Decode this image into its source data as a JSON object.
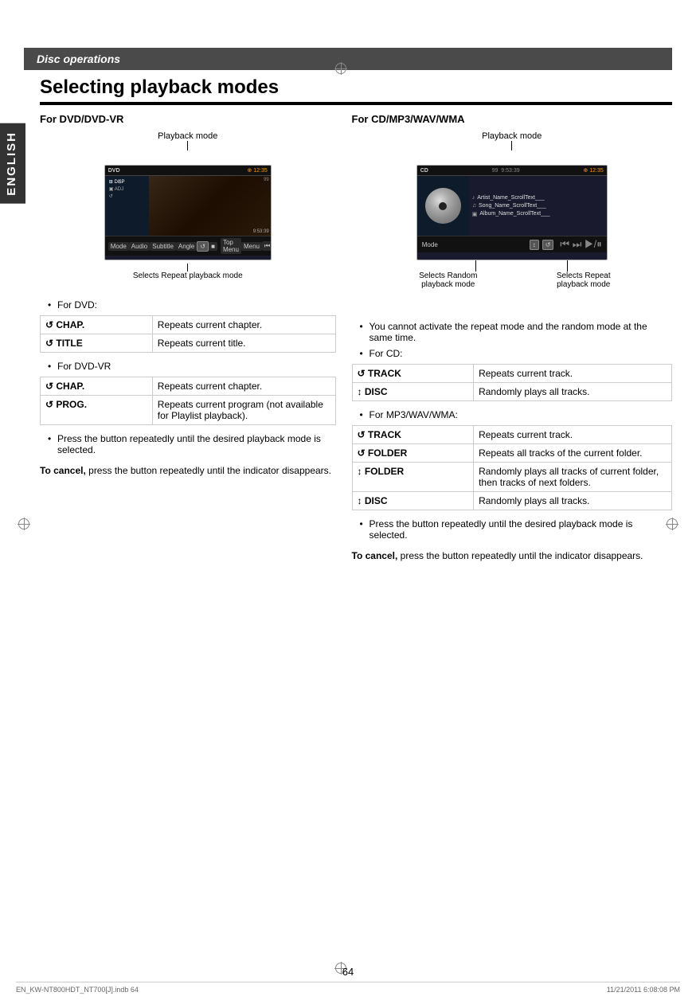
{
  "header": {
    "section": "Disc operations",
    "title": "Selecting playback modes"
  },
  "sidebar": {
    "label": "ENGLISH"
  },
  "left_column": {
    "section_title": "For DVD/DVD-VR",
    "screen_label": "Playback mode",
    "screen_caption": "Selects Repeat playback mode",
    "dvd_section": {
      "title": "For DVD:",
      "rows": [
        {
          "key": "↺ CHAP.",
          "value": "Repeats current chapter."
        },
        {
          "key": "↺ TITLE",
          "value": "Repeats current title."
        }
      ]
    },
    "dvdvr_section": {
      "title": "For DVD-VR",
      "rows": [
        {
          "key": "↺ CHAP.",
          "value": "Repeats current chapter."
        },
        {
          "key": "↺ PROG.",
          "value": "Repeats current program (not available for Playlist playback)."
        }
      ]
    },
    "press_note": "Press the button repeatedly until the desired playback mode is selected.",
    "cancel_label": "To cancel,",
    "cancel_text": "press the button repeatedly until the indicator disappears."
  },
  "right_column": {
    "section_title": "For CD/MP3/WAV/WMA",
    "screen_label": "Playback mode",
    "ann_left": "Selects Random playback mode",
    "ann_right": "Selects Repeat playback mode",
    "cannot_note": "You cannot activate the repeat mode and the random mode at the same time.",
    "cd_section": {
      "title": "For CD:",
      "rows": [
        {
          "key": "↺ TRACK",
          "value": "Repeats current track."
        },
        {
          "key": "↕ DISC",
          "value": "Randomly plays all tracks."
        }
      ]
    },
    "mp3_section": {
      "title": "For MP3/WAV/WMA:",
      "rows": [
        {
          "key": "↺ TRACK",
          "value": "Repeats current track."
        },
        {
          "key": "↺ FOLDER",
          "value": "Repeats all tracks of the current folder."
        },
        {
          "key": "↕ FOLDER",
          "value": "Randomly plays all tracks of current folder, then tracks of next folders."
        },
        {
          "key": "↕ DISC",
          "value": "Randomly plays all tracks."
        }
      ]
    },
    "press_note": "Press the button repeatedly until the desired playback mode is selected.",
    "cancel_label": "To cancel,",
    "cancel_text": "press the button repeatedly until the indicator disappears."
  },
  "page_number": "64",
  "footer": {
    "left": "EN_KW-NT800HDT_NT700[J].indb   64",
    "right": "11/21/2011   6:08:08 PM"
  }
}
